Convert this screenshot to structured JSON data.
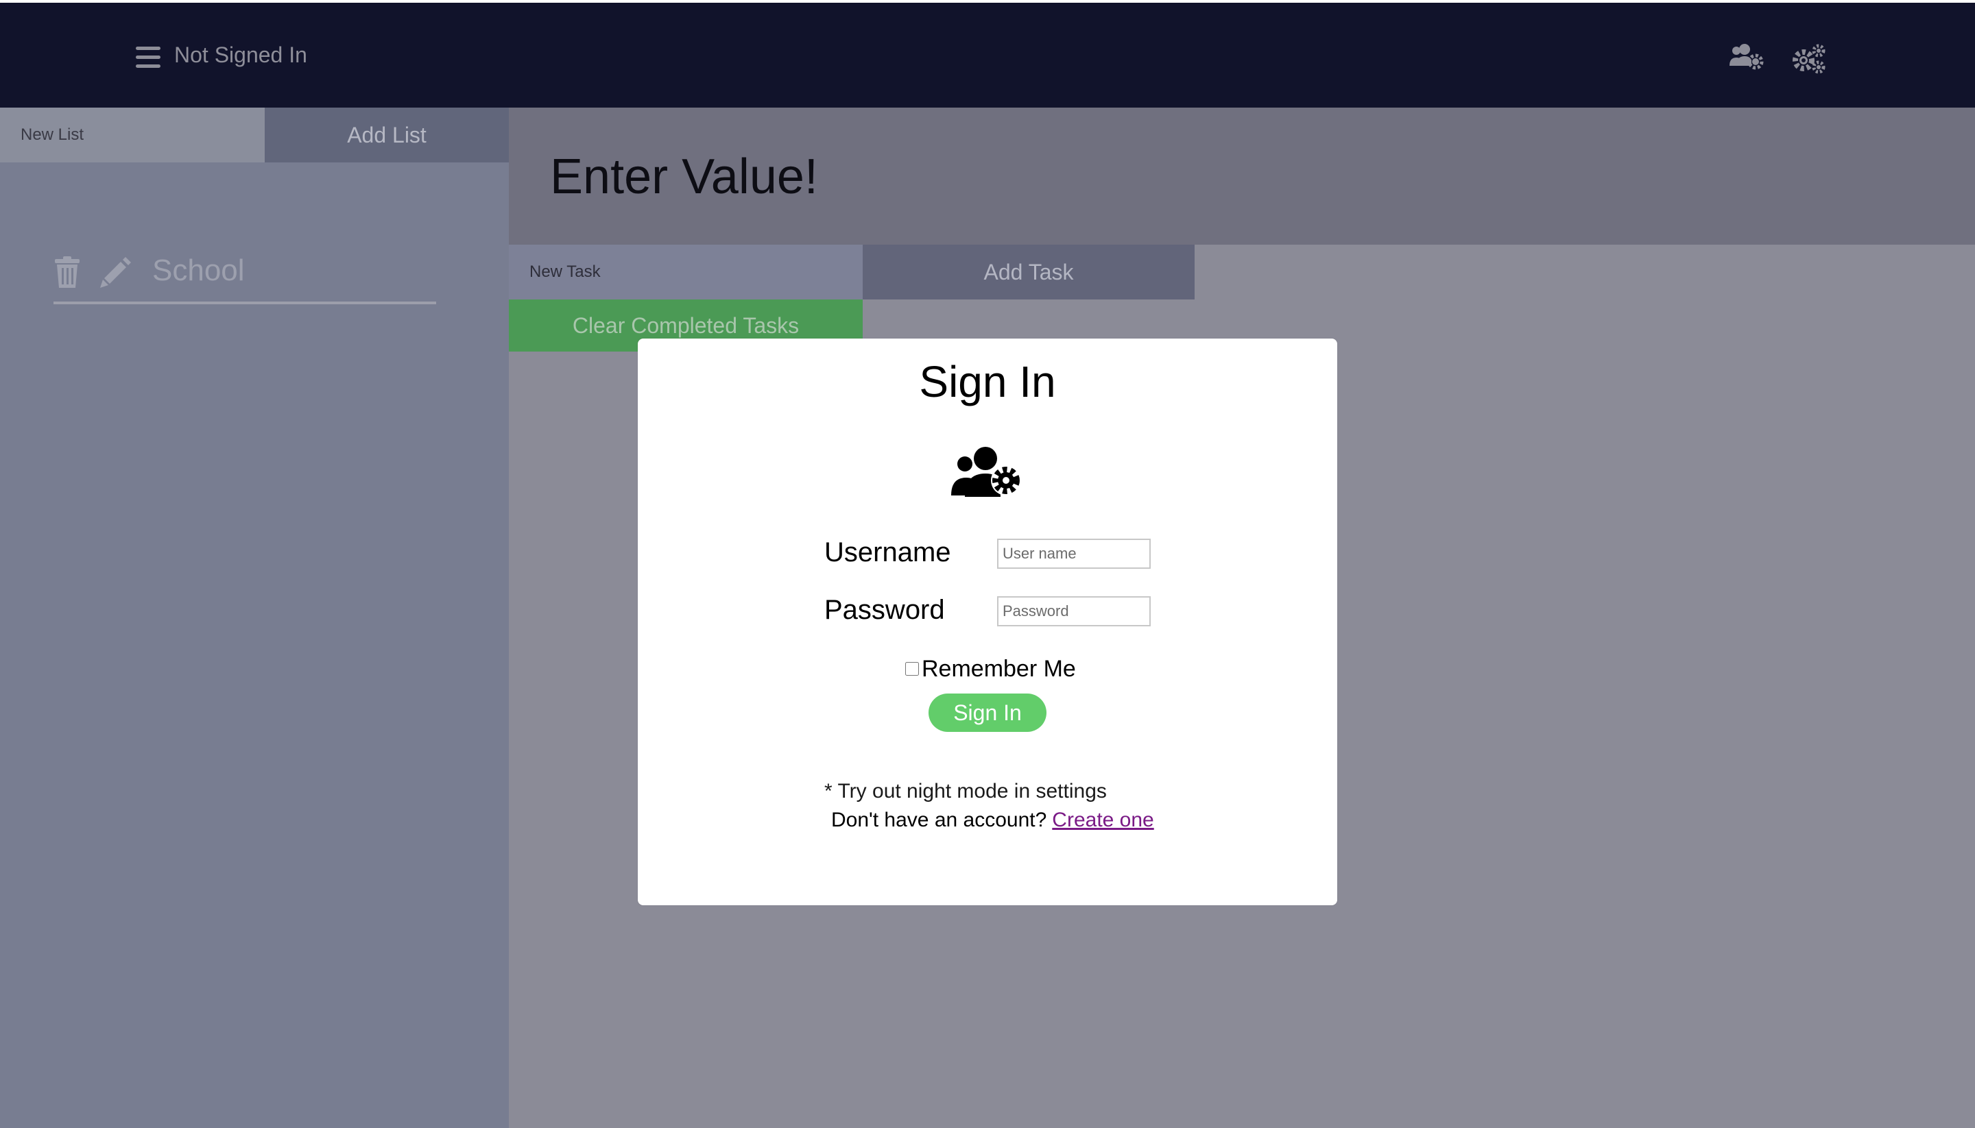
{
  "header": {
    "status_text": "Not Signed In",
    "menu_icon": "hamburger-icon",
    "account_icon": "users-cog-icon",
    "settings_icon": "cogs-icon",
    "background": "#11132b"
  },
  "sidebar": {
    "new_list_placeholder": "New List",
    "add_list_label": "Add List",
    "lists": [
      {
        "name": "School",
        "icons": [
          "trash-icon",
          "pencil-icon"
        ]
      }
    ]
  },
  "main": {
    "title": "Enter Value!",
    "new_task_placeholder": "New Task",
    "add_task_label": "Add Task",
    "clear_completed_label": "Clear Completed Tasks"
  },
  "modal": {
    "title": "Sign In",
    "icon": "users-cog-icon",
    "username_label": "Username",
    "username_placeholder": "User name",
    "password_label": "Password",
    "password_placeholder": "Password",
    "remember_label": "Remember Me",
    "remember_checked": false,
    "submit_label": "Sign In",
    "hint": "* Try out night mode in settings",
    "account_prompt": "Don't have an account?",
    "create_link": "Create one",
    "accent_color": "#62cd6a",
    "link_color": "#7a1a86"
  }
}
